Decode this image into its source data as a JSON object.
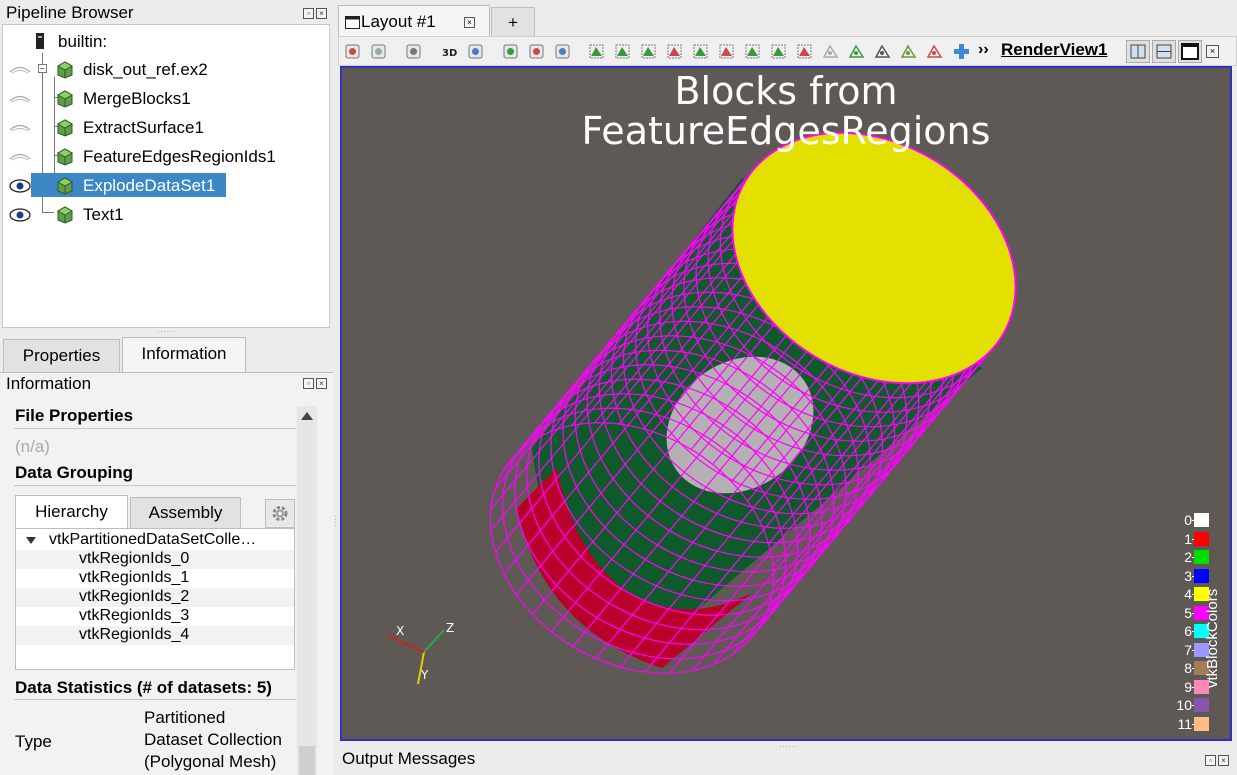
{
  "pipeline": {
    "title": "Pipeline Browser",
    "root": "builtin:",
    "items": [
      {
        "label": "disk_out_ref.ex2",
        "visible": false,
        "selected": false
      },
      {
        "label": "MergeBlocks1",
        "visible": false,
        "selected": false
      },
      {
        "label": "ExtractSurface1",
        "visible": false,
        "selected": false
      },
      {
        "label": "FeatureEdgesRegionIds1",
        "visible": false,
        "selected": false
      },
      {
        "label": "ExplodeDataSet1",
        "visible": true,
        "selected": true
      },
      {
        "label": "Text1",
        "visible": true,
        "selected": false
      }
    ]
  },
  "panel_tabs": {
    "properties": "Properties",
    "information": "Information",
    "active": "Information"
  },
  "info": {
    "title": "Information",
    "file_properties_heading": "File Properties",
    "file_properties_value": "(n/a)",
    "data_grouping_heading": "Data Grouping",
    "grouping_tabs": {
      "hierarchy": "Hierarchy",
      "assembly": "Assembly",
      "active": "Hierarchy"
    },
    "hierarchy": {
      "root": "vtkPartitionedDataSetColle…",
      "children": [
        "vtkRegionIds_0",
        "vtkRegionIds_1",
        "vtkRegionIds_2",
        "vtkRegionIds_3",
        "vtkRegionIds_4"
      ]
    },
    "data_statistics_heading": "Data Statistics (# of datasets: 5)",
    "stats": {
      "type_label": "Type",
      "type_value_lines": [
        "Partitioned",
        "Dataset Collection",
        "(Polygonal Mesh)"
      ]
    }
  },
  "layout": {
    "tab_label": "Layout #1",
    "new_tab_label": "+",
    "more_label": "››",
    "view_name": "RenderView1",
    "toolbar_icons": [
      "reset-camera-icon",
      "zoom-closest-icon",
      "screenshot-icon",
      "3d-toggle-icon",
      "zoom-to-box-icon",
      "show-center-icon",
      "hide-center-icon",
      "pick-center-icon",
      "select-cells-on-icon",
      "select-points-on-icon",
      "select-cells-frustum-icon",
      "select-points-frustum-icon",
      "select-cells-polygon-icon",
      "select-points-polygon-icon",
      "select-blocks-icon",
      "interactive-select-cells-icon",
      "interactive-select-points-icon",
      "hover-points-icon",
      "hover-cells-icon",
      "grow-selection-icon",
      "shrink-selection-icon",
      "edit-selection-icon",
      "clear-selection-icon",
      "add-ruler-icon"
    ],
    "view_3d_label": "3D"
  },
  "render": {
    "title_line1": "Blocks from",
    "title_line2": "FeatureEdgesRegions",
    "background": "#5e5955",
    "legend_title": "vtkBlockColors",
    "legend": [
      {
        "label": "0",
        "color": "#ffffff"
      },
      {
        "label": "1",
        "color": "#ff0000"
      },
      {
        "label": "2",
        "color": "#00dd00"
      },
      {
        "label": "3",
        "color": "#0000ff"
      },
      {
        "label": "4",
        "color": "#ffff00"
      },
      {
        "label": "5",
        "color": "#ff00ff"
      },
      {
        "label": "6",
        "color": "#00ffff"
      },
      {
        "label": "7",
        "color": "#9999ff"
      },
      {
        "label": "8",
        "color": "#a67c58"
      },
      {
        "label": "9",
        "color": "#ff88bb"
      },
      {
        "label": "10",
        "color": "#8855aa"
      },
      {
        "label": "11",
        "color": "#ffbb88"
      }
    ],
    "axes": {
      "x": "X",
      "y": "Y",
      "z": "Z"
    }
  },
  "output": {
    "title": "Output Messages"
  }
}
